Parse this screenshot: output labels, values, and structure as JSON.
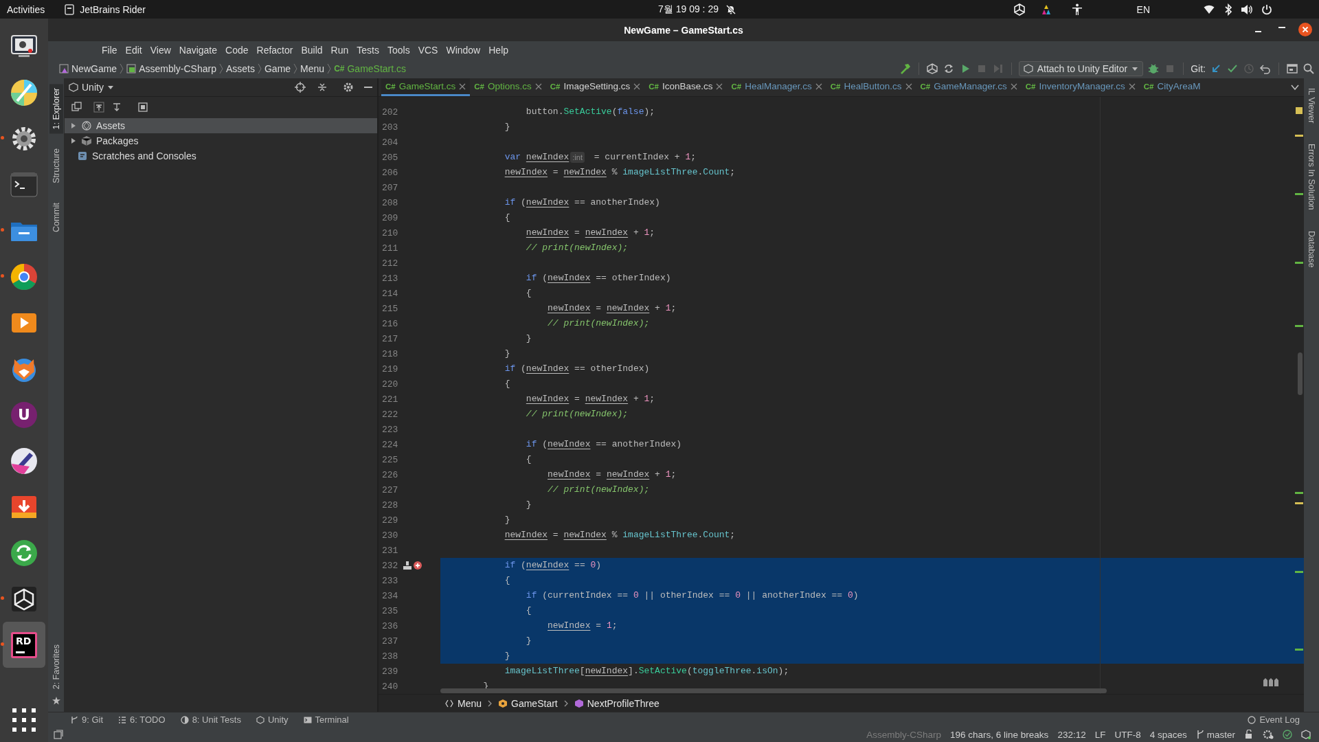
{
  "top_bar": {
    "activities": "Activities",
    "app": "JetBrains Rider",
    "clock": "7월 19 09 : 29",
    "language": "EN"
  },
  "dock": [
    {
      "running": false,
      "selected": false
    },
    {
      "running": false,
      "selected": false
    },
    {
      "running": true,
      "selected": false
    },
    {
      "running": false,
      "selected": false
    },
    {
      "running": true,
      "selected": false
    },
    {
      "running": true,
      "selected": false
    },
    {
      "running": false,
      "selected": false
    },
    {
      "running": false,
      "selected": false
    },
    {
      "running": false,
      "selected": false,
      "glyph": "U"
    },
    {
      "running": false,
      "selected": false
    },
    {
      "running": false,
      "selected": false
    },
    {
      "running": false,
      "selected": false
    },
    {
      "running": true,
      "selected": false
    },
    {
      "running": true,
      "selected": true,
      "glyph": "RD"
    }
  ],
  "window": {
    "title": "NewGame – GameStart.cs"
  },
  "menu": [
    "File",
    "Edit",
    "View",
    "Navigate",
    "Code",
    "Refactor",
    "Build",
    "Run",
    "Tests",
    "Tools",
    "VCS",
    "Window",
    "Help"
  ],
  "nav_path": [
    {
      "label": "NewGame"
    },
    {
      "label": "Assembly-CSharp"
    },
    {
      "label": "Assets"
    },
    {
      "label": "Game"
    },
    {
      "label": "Menu"
    },
    {
      "label": "GameStart.cs",
      "badge": "C#"
    }
  ],
  "run_config": "Attach to Unity Editor",
  "git_label": "Git:",
  "left_tool_tabs": [
    {
      "label": "1: Explorer",
      "selected": true
    },
    {
      "label": "Structure",
      "selected": false
    },
    {
      "label": "Commit",
      "selected": false
    }
  ],
  "left_bottom_tabs": [
    {
      "label": "2: Favorites",
      "selected": false
    }
  ],
  "explorer": {
    "view": "Unity",
    "tree": [
      {
        "label": "Assets",
        "expanded": false,
        "selected": true
      },
      {
        "label": "Packages",
        "expanded": false,
        "selected": false
      },
      {
        "label": "Scratches and Consoles",
        "selected": false
      }
    ]
  },
  "editor_tabs": [
    {
      "badge": "C#",
      "label": "GameStart.cs",
      "selected": true,
      "color": "#62b543"
    },
    {
      "badge": "C#",
      "label": "Options.cs",
      "selected": false,
      "color": "#62b543"
    },
    {
      "badge": "C#",
      "label": "ImageSetting.cs",
      "selected": false,
      "color": "#d4d4d4"
    },
    {
      "badge": "C#",
      "label": "IconBase.cs",
      "selected": false,
      "color": "#d4d4d4"
    },
    {
      "badge": "C#",
      "label": "HealManager.cs",
      "selected": false,
      "color": "#6897bb"
    },
    {
      "badge": "C#",
      "label": "HealButton.cs",
      "selected": false,
      "color": "#6897bb"
    },
    {
      "badge": "C#",
      "label": "GameManager.cs",
      "selected": false,
      "color": "#6897bb"
    },
    {
      "badge": "C#",
      "label": "InventoryManager.cs",
      "selected": false,
      "color": "#6897bb"
    },
    {
      "badge": "C#",
      "label": "CityAreaM",
      "selected": false,
      "color": "#6897bb"
    }
  ],
  "code_lines": [
    {
      "number": "202",
      "selected": false,
      "marked": false,
      "tokens": [
        {
          "kind": "p",
          "text": "                button."
        },
        {
          "kind": "m",
          "text": "SetActive"
        },
        {
          "kind": "p",
          "text": "("
        },
        {
          "kind": "k",
          "text": "false"
        },
        {
          "kind": "p",
          "text": ");"
        }
      ]
    },
    {
      "number": "203",
      "selected": false,
      "marked": false,
      "tokens": [
        {
          "kind": "p",
          "text": "            }"
        }
      ]
    },
    {
      "number": "204",
      "selected": false,
      "marked": false
    },
    {
      "number": "205",
      "selected": false,
      "marked": false,
      "tokens": [
        {
          "kind": "k",
          "text": "            var"
        },
        {
          "kind": "u",
          "text": " newIndex"
        },
        {
          "kind": "h",
          "text": ":int"
        },
        {
          "kind": "p",
          "text": " = currentIndex + "
        },
        {
          "kind": "n",
          "text": "1"
        },
        {
          "kind": "p",
          "text": ";"
        }
      ]
    },
    {
      "number": "206",
      "selected": false,
      "marked": false,
      "tokens": [
        {
          "kind": "u",
          "text": "            newIndex"
        },
        {
          "kind": "p",
          "text": " = "
        },
        {
          "kind": "u",
          "text": "newIndex"
        },
        {
          "kind": "p",
          "text": " % "
        },
        {
          "kind": "f",
          "text": "imageListThree"
        },
        {
          "kind": "p",
          "text": "."
        },
        {
          "kind": "f",
          "text": "Count"
        },
        {
          "kind": "p",
          "text": ";"
        }
      ]
    },
    {
      "number": "207",
      "selected": false,
      "marked": false
    },
    {
      "number": "208",
      "selected": false,
      "marked": false,
      "tokens": [
        {
          "kind": "k",
          "text": "            if"
        },
        {
          "kind": "p",
          "text": " ("
        },
        {
          "kind": "u",
          "text": "newIndex"
        },
        {
          "kind": "p",
          "text": " == anotherIndex)"
        }
      ]
    },
    {
      "number": "209",
      "selected": false,
      "marked": false,
      "tokens": [
        {
          "kind": "p",
          "text": "            {"
        }
      ]
    },
    {
      "number": "210",
      "selected": false,
      "marked": false,
      "tokens": [
        {
          "kind": "u",
          "text": "                newIndex"
        },
        {
          "kind": "p",
          "text": " = "
        },
        {
          "kind": "u",
          "text": "newIndex"
        },
        {
          "kind": "p",
          "text": " + "
        },
        {
          "kind": "n",
          "text": "1"
        },
        {
          "kind": "p",
          "text": ";"
        }
      ]
    },
    {
      "number": "211",
      "selected": false,
      "marked": false,
      "tokens": [
        {
          "kind": "c",
          "text": "                // print(newIndex);"
        }
      ]
    },
    {
      "number": "212",
      "selected": false,
      "marked": false
    },
    {
      "number": "213",
      "selected": false,
      "marked": false,
      "tokens": [
        {
          "kind": "k",
          "text": "                if"
        },
        {
          "kind": "p",
          "text": " ("
        },
        {
          "kind": "u",
          "text": "newIndex"
        },
        {
          "kind": "p",
          "text": " == otherIndex)"
        }
      ]
    },
    {
      "number": "214",
      "selected": false,
      "marked": false,
      "tokens": [
        {
          "kind": "p",
          "text": "                {"
        }
      ]
    },
    {
      "number": "215",
      "selected": false,
      "marked": false,
      "tokens": [
        {
          "kind": "u",
          "text": "                    newIndex"
        },
        {
          "kind": "p",
          "text": " = "
        },
        {
          "kind": "u",
          "text": "newIndex"
        },
        {
          "kind": "p",
          "text": " + "
        },
        {
          "kind": "n",
          "text": "1"
        },
        {
          "kind": "p",
          "text": ";"
        }
      ]
    },
    {
      "number": "216",
      "selected": false,
      "marked": false,
      "tokens": [
        {
          "kind": "c",
          "text": "                    // print(newIndex);"
        }
      ]
    },
    {
      "number": "217",
      "selected": false,
      "marked": false,
      "tokens": [
        {
          "kind": "p",
          "text": "                }"
        }
      ]
    },
    {
      "number": "218",
      "selected": false,
      "marked": false,
      "tokens": [
        {
          "kind": "p",
          "text": "            }"
        }
      ]
    },
    {
      "number": "219",
      "selected": false,
      "marked": false,
      "tokens": [
        {
          "kind": "k",
          "text": "            if"
        },
        {
          "kind": "p",
          "text": " ("
        },
        {
          "kind": "u",
          "text": "newIndex"
        },
        {
          "kind": "p",
          "text": " == otherIndex)"
        }
      ]
    },
    {
      "number": "220",
      "selected": false,
      "marked": false,
      "tokens": [
        {
          "kind": "p",
          "text": "            {"
        }
      ]
    },
    {
      "number": "221",
      "selected": false,
      "marked": false,
      "tokens": [
        {
          "kind": "u",
          "text": "                newIndex"
        },
        {
          "kind": "p",
          "text": " = "
        },
        {
          "kind": "u",
          "text": "newIndex"
        },
        {
          "kind": "p",
          "text": " + "
        },
        {
          "kind": "n",
          "text": "1"
        },
        {
          "kind": "p",
          "text": ";"
        }
      ]
    },
    {
      "number": "222",
      "selected": false,
      "marked": false,
      "tokens": [
        {
          "kind": "c",
          "text": "                // print(newIndex);"
        }
      ]
    },
    {
      "number": "223",
      "selected": false,
      "marked": false
    },
    {
      "number": "224",
      "selected": false,
      "marked": false,
      "tokens": [
        {
          "kind": "k",
          "text": "                if"
        },
        {
          "kind": "p",
          "text": " ("
        },
        {
          "kind": "u",
          "text": "newIndex"
        },
        {
          "kind": "p",
          "text": " == anotherIndex)"
        }
      ]
    },
    {
      "number": "225",
      "selected": false,
      "marked": false,
      "tokens": [
        {
          "kind": "p",
          "text": "                {"
        }
      ]
    },
    {
      "number": "226",
      "selected": false,
      "marked": false,
      "tokens": [
        {
          "kind": "u",
          "text": "                    newIndex"
        },
        {
          "kind": "p",
          "text": " = "
        },
        {
          "kind": "u",
          "text": "newIndex"
        },
        {
          "kind": "p",
          "text": " + "
        },
        {
          "kind": "n",
          "text": "1"
        },
        {
          "kind": "p",
          "text": ";"
        }
      ]
    },
    {
      "number": "227",
      "selected": false,
      "marked": false,
      "tokens": [
        {
          "kind": "c",
          "text": "                    // print(newIndex);"
        }
      ]
    },
    {
      "number": "228",
      "selected": false,
      "marked": false,
      "tokens": [
        {
          "kind": "p",
          "text": "                }"
        }
      ]
    },
    {
      "number": "229",
      "selected": false,
      "marked": false,
      "tokens": [
        {
          "kind": "p",
          "text": "            }"
        }
      ]
    },
    {
      "number": "230",
      "selected": false,
      "marked": false,
      "tokens": [
        {
          "kind": "u",
          "text": "            newIndex"
        },
        {
          "kind": "p",
          "text": " = "
        },
        {
          "kind": "u",
          "text": "newIndex"
        },
        {
          "kind": "p",
          "text": " % "
        },
        {
          "kind": "f",
          "text": "imageListThree"
        },
        {
          "kind": "p",
          "text": "."
        },
        {
          "kind": "f",
          "text": "Count"
        },
        {
          "kind": "p",
          "text": ";"
        }
      ]
    },
    {
      "number": "231",
      "selected": false,
      "marked": false
    },
    {
      "number": "232",
      "selected": true,
      "marked": true,
      "tokens": [
        {
          "kind": "k",
          "text": "            if"
        },
        {
          "kind": "p",
          "text": " ("
        },
        {
          "kind": "u",
          "text": "newIndex"
        },
        {
          "kind": "p",
          "text": " == "
        },
        {
          "kind": "n",
          "text": "0"
        },
        {
          "kind": "p",
          "text": ")"
        }
      ]
    },
    {
      "number": "233",
      "selected": true,
      "marked": false,
      "tokens": [
        {
          "kind": "p",
          "text": "            {"
        }
      ]
    },
    {
      "number": "234",
      "selected": true,
      "marked": false,
      "tokens": [
        {
          "kind": "k",
          "text": "                if"
        },
        {
          "kind": "p",
          "text": " (currentIndex == "
        },
        {
          "kind": "n",
          "text": "0"
        },
        {
          "kind": "p",
          "text": " || otherIndex == "
        },
        {
          "kind": "n",
          "text": "0"
        },
        {
          "kind": "p",
          "text": " || anotherIndex == "
        },
        {
          "kind": "n",
          "text": "0"
        },
        {
          "kind": "p",
          "text": ")"
        }
      ]
    },
    {
      "number": "235",
      "selected": true,
      "marked": false,
      "tokens": [
        {
          "kind": "p",
          "text": "                {"
        }
      ]
    },
    {
      "number": "236",
      "selected": true,
      "marked": false,
      "tokens": [
        {
          "kind": "u",
          "text": "                    newIndex"
        },
        {
          "kind": "p",
          "text": " = "
        },
        {
          "kind": "n",
          "text": "1"
        },
        {
          "kind": "p",
          "text": ";"
        }
      ]
    },
    {
      "number": "237",
      "selected": true,
      "marked": false,
      "tokens": [
        {
          "kind": "p",
          "text": "                }"
        }
      ]
    },
    {
      "number": "238",
      "selected": true,
      "marked": false,
      "tokens": [
        {
          "kind": "p",
          "text": "            }"
        }
      ]
    },
    {
      "number": "239",
      "selected": false,
      "marked": false,
      "tokens": [
        {
          "kind": "f",
          "text": "            imageListThree"
        },
        {
          "kind": "p",
          "text": "["
        },
        {
          "kind": "u",
          "text": "newIndex"
        },
        {
          "kind": "p",
          "text": "]."
        },
        {
          "kind": "m",
          "text": "SetActive"
        },
        {
          "kind": "p",
          "text": "("
        },
        {
          "kind": "f",
          "text": "toggleThree"
        },
        {
          "kind": "p",
          "text": "."
        },
        {
          "kind": "f",
          "text": "isOn"
        },
        {
          "kind": "p",
          "text": ");"
        }
      ]
    },
    {
      "number": "240",
      "selected": false,
      "marked": false,
      "tokens": [
        {
          "kind": "p",
          "text": "        }"
        }
      ]
    }
  ],
  "breadcrumbs": [
    "Menu",
    "GameStart",
    "NextProfileThree"
  ],
  "right_tool_tabs": [
    "IL Viewer",
    "Errors In Solution",
    "Database"
  ],
  "tool_windows": [
    "9: Git",
    "6: TODO",
    "8: Unit Tests",
    "Unity",
    "Terminal"
  ],
  "event_log": "Event Log",
  "status": [
    {
      "text": "Assembly-CSharp",
      "disabled": true
    },
    {
      "text": "196 chars, 6 line breaks",
      "disabled": false
    },
    {
      "text": "232:12",
      "disabled": false
    },
    {
      "text": "LF",
      "disabled": false
    },
    {
      "text": "UTF-8",
      "disabled": false
    },
    {
      "text": "4 spaces",
      "disabled": false
    },
    {
      "text": "master",
      "disabled": false
    }
  ]
}
